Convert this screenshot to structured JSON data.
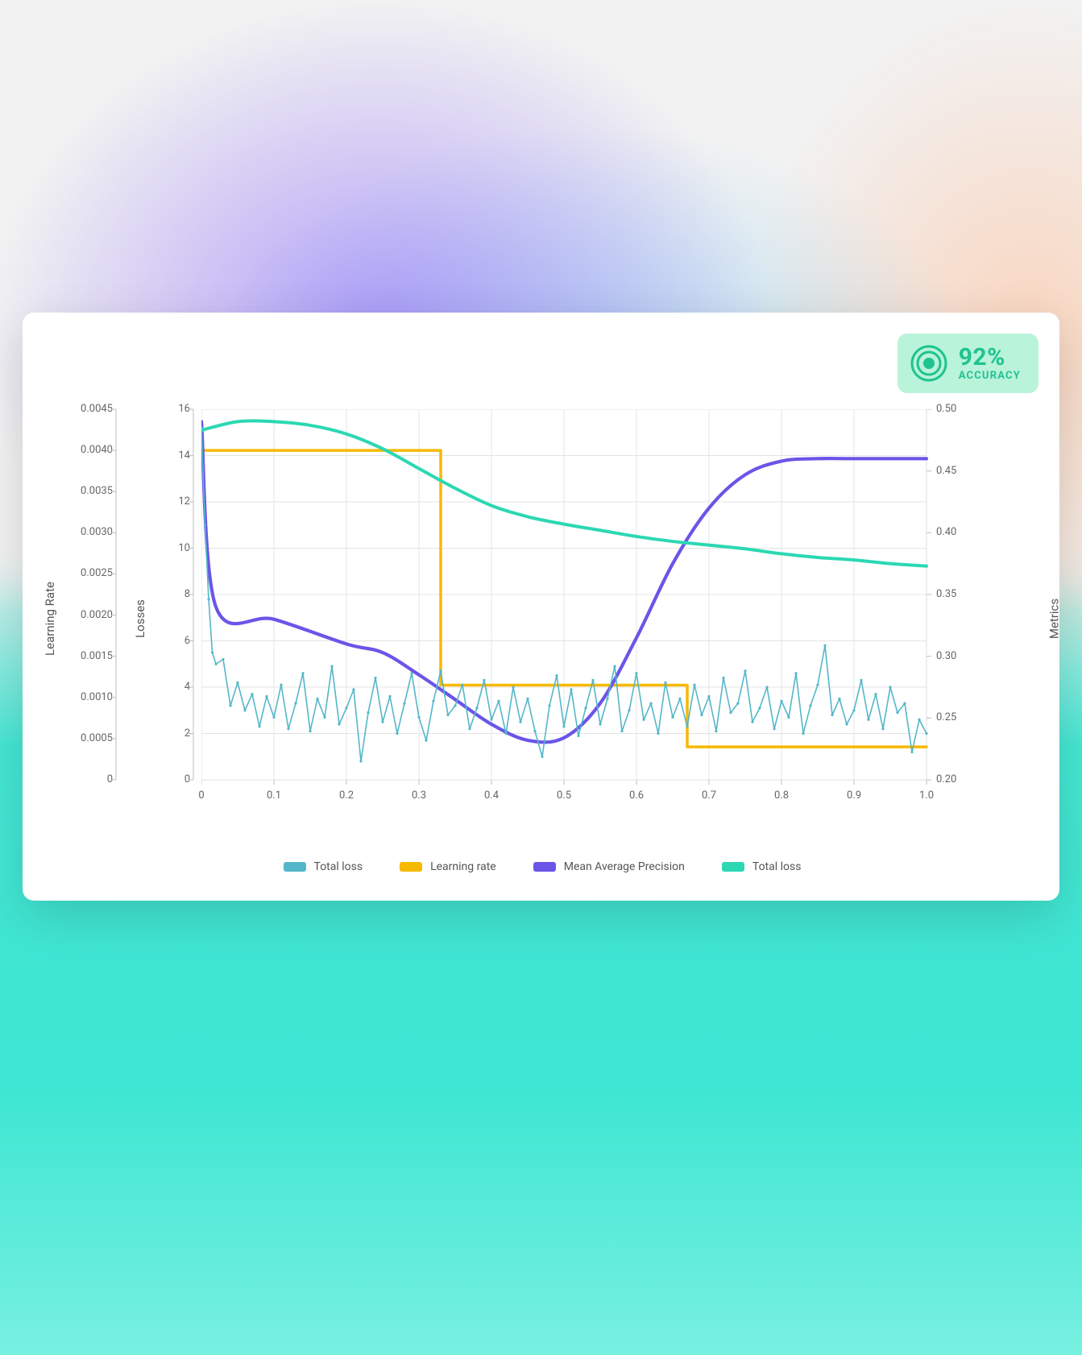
{
  "badge": {
    "percent": "92%",
    "label": "ACCURACY"
  },
  "axis_titles": {
    "learning_rate": "Learning Rate",
    "losses": "Losses",
    "metrics": "Metrics"
  },
  "colors": {
    "total_loss_noisy": "#54b7c9",
    "learning_rate": "#f6b900",
    "mean_avg_precision": "#6a55e8",
    "total_loss_smooth": "#2bd8b3",
    "grid": "#e4e4e4",
    "tick_mark": "#bdbdbd"
  },
  "legend": [
    {
      "label": "Total  loss",
      "color_key": "total_loss_noisy"
    },
    {
      "label": "Learning rate",
      "color_key": "learning_rate"
    },
    {
      "label": "Mean Average Precision",
      "color_key": "mean_avg_precision"
    },
    {
      "label": "Total loss",
      "color_key": "total_loss_smooth"
    }
  ],
  "chart_data": {
    "type": "line",
    "x": {
      "range": [
        0,
        1.0
      ],
      "ticks": [
        0,
        0.1,
        0.2,
        0.3,
        0.4,
        0.5,
        0.6,
        0.7,
        0.8,
        0.9,
        1.0
      ]
    },
    "y_axes": {
      "learning_rate": {
        "range": [
          0,
          0.0045
        ],
        "ticks": [
          0,
          0.0005,
          0.001,
          0.0015,
          0.002,
          0.0025,
          0.003,
          0.0035,
          0.004,
          0.0045
        ]
      },
      "losses": {
        "range": [
          0,
          16
        ],
        "ticks": [
          0,
          2,
          4,
          6,
          8,
          10,
          12,
          14,
          16
        ]
      },
      "metrics": {
        "range": [
          0.2,
          0.5
        ],
        "ticks": [
          0.2,
          0.25,
          0.3,
          0.35,
          0.4,
          0.45,
          0.5
        ]
      }
    },
    "series": [
      {
        "name": "Learning rate",
        "axis": "learning_rate",
        "points": [
          [
            0,
            0.004
          ],
          [
            0.33,
            0.004
          ],
          [
            0.33,
            0.00115
          ],
          [
            0.67,
            0.00115
          ],
          [
            0.67,
            0.0004
          ],
          [
            1.0,
            0.0004
          ]
        ]
      },
      {
        "name": "Mean Average Precision",
        "axis": "metrics",
        "points": [
          [
            0,
            0.49
          ],
          [
            0.02,
            0.34
          ],
          [
            0.1,
            0.33
          ],
          [
            0.2,
            0.31
          ],
          [
            0.25,
            0.303
          ],
          [
            0.3,
            0.285
          ],
          [
            0.35,
            0.265
          ],
          [
            0.4,
            0.245
          ],
          [
            0.45,
            0.232
          ],
          [
            0.5,
            0.234
          ],
          [
            0.55,
            0.262
          ],
          [
            0.6,
            0.315
          ],
          [
            0.65,
            0.375
          ],
          [
            0.7,
            0.42
          ],
          [
            0.75,
            0.447
          ],
          [
            0.8,
            0.458
          ],
          [
            0.85,
            0.46
          ],
          [
            0.9,
            0.46
          ],
          [
            1.0,
            0.46
          ]
        ]
      },
      {
        "name": "Total loss (smooth)",
        "axis": "metrics",
        "points": [
          [
            0,
            0.483
          ],
          [
            0.05,
            0.49
          ],
          [
            0.1,
            0.49
          ],
          [
            0.15,
            0.487
          ],
          [
            0.2,
            0.48
          ],
          [
            0.25,
            0.468
          ],
          [
            0.3,
            0.452
          ],
          [
            0.35,
            0.436
          ],
          [
            0.4,
            0.422
          ],
          [
            0.45,
            0.413
          ],
          [
            0.5,
            0.407
          ],
          [
            0.55,
            0.402
          ],
          [
            0.6,
            0.397
          ],
          [
            0.65,
            0.393
          ],
          [
            0.7,
            0.39
          ],
          [
            0.75,
            0.387
          ],
          [
            0.8,
            0.383
          ],
          [
            0.85,
            0.38
          ],
          [
            0.9,
            0.378
          ],
          [
            0.95,
            0.375
          ],
          [
            1.0,
            0.373
          ]
        ]
      },
      {
        "name": "Total loss (noisy)",
        "axis": "losses",
        "points": [
          [
            0.0,
            15.2
          ],
          [
            0.005,
            11.0
          ],
          [
            0.01,
            7.8
          ],
          [
            0.015,
            5.5
          ],
          [
            0.02,
            5.0
          ],
          [
            0.03,
            5.2
          ],
          [
            0.04,
            3.2
          ],
          [
            0.05,
            4.2
          ],
          [
            0.06,
            3.0
          ],
          [
            0.07,
            3.7
          ],
          [
            0.08,
            2.3
          ],
          [
            0.09,
            3.6
          ],
          [
            0.1,
            2.7
          ],
          [
            0.11,
            4.1
          ],
          [
            0.12,
            2.2
          ],
          [
            0.13,
            3.3
          ],
          [
            0.14,
            4.6
          ],
          [
            0.15,
            2.1
          ],
          [
            0.16,
            3.5
          ],
          [
            0.17,
            2.7
          ],
          [
            0.18,
            4.9
          ],
          [
            0.19,
            2.4
          ],
          [
            0.2,
            3.1
          ],
          [
            0.21,
            3.9
          ],
          [
            0.22,
            0.8
          ],
          [
            0.23,
            2.9
          ],
          [
            0.24,
            4.4
          ],
          [
            0.25,
            2.5
          ],
          [
            0.26,
            3.6
          ],
          [
            0.27,
            2.0
          ],
          [
            0.28,
            3.3
          ],
          [
            0.29,
            4.6
          ],
          [
            0.3,
            2.7
          ],
          [
            0.31,
            1.7
          ],
          [
            0.32,
            3.4
          ],
          [
            0.33,
            4.7
          ],
          [
            0.34,
            2.8
          ],
          [
            0.35,
            3.2
          ],
          [
            0.36,
            4.1
          ],
          [
            0.37,
            2.2
          ],
          [
            0.38,
            3.1
          ],
          [
            0.39,
            4.3
          ],
          [
            0.4,
            2.6
          ],
          [
            0.41,
            3.4
          ],
          [
            0.42,
            2.0
          ],
          [
            0.43,
            4.0
          ],
          [
            0.44,
            2.5
          ],
          [
            0.45,
            3.5
          ],
          [
            0.46,
            2.1
          ],
          [
            0.47,
            1.0
          ],
          [
            0.48,
            3.2
          ],
          [
            0.49,
            4.5
          ],
          [
            0.5,
            2.3
          ],
          [
            0.51,
            3.9
          ],
          [
            0.52,
            1.9
          ],
          [
            0.53,
            3.1
          ],
          [
            0.54,
            4.3
          ],
          [
            0.55,
            2.4
          ],
          [
            0.56,
            3.5
          ],
          [
            0.57,
            4.9
          ],
          [
            0.58,
            2.1
          ],
          [
            0.59,
            3.0
          ],
          [
            0.6,
            4.6
          ],
          [
            0.61,
            2.6
          ],
          [
            0.62,
            3.3
          ],
          [
            0.63,
            2.0
          ],
          [
            0.64,
            4.2
          ],
          [
            0.65,
            2.7
          ],
          [
            0.66,
            3.5
          ],
          [
            0.67,
            2.3
          ],
          [
            0.68,
            4.1
          ],
          [
            0.69,
            2.8
          ],
          [
            0.7,
            3.6
          ],
          [
            0.71,
            2.1
          ],
          [
            0.72,
            4.4
          ],
          [
            0.73,
            2.9
          ],
          [
            0.74,
            3.3
          ],
          [
            0.75,
            4.7
          ],
          [
            0.76,
            2.5
          ],
          [
            0.77,
            3.1
          ],
          [
            0.78,
            4.0
          ],
          [
            0.79,
            2.2
          ],
          [
            0.8,
            3.4
          ],
          [
            0.81,
            2.7
          ],
          [
            0.82,
            4.6
          ],
          [
            0.83,
            2.0
          ],
          [
            0.84,
            3.2
          ],
          [
            0.85,
            4.1
          ],
          [
            0.86,
            5.8
          ],
          [
            0.87,
            2.8
          ],
          [
            0.88,
            3.5
          ],
          [
            0.89,
            2.4
          ],
          [
            0.9,
            3.0
          ],
          [
            0.91,
            4.3
          ],
          [
            0.92,
            2.6
          ],
          [
            0.93,
            3.7
          ],
          [
            0.94,
            2.2
          ],
          [
            0.95,
            4.0
          ],
          [
            0.96,
            2.9
          ],
          [
            0.97,
            3.3
          ],
          [
            0.98,
            1.2
          ],
          [
            0.99,
            2.6
          ],
          [
            1.0,
            2.0
          ]
        ]
      }
    ]
  }
}
